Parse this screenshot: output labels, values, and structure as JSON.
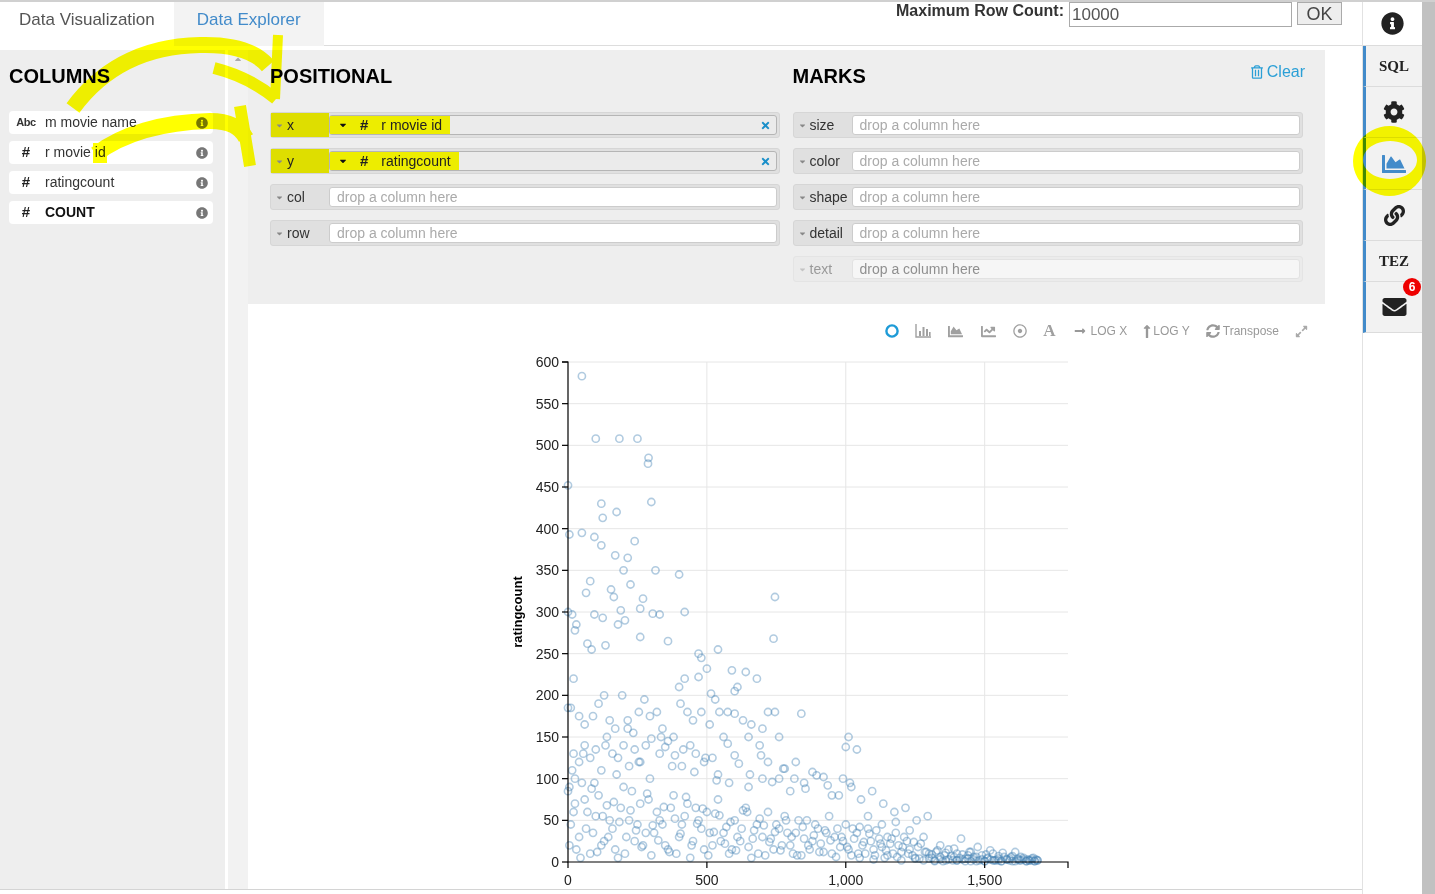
{
  "tabs": [
    {
      "label": "Data Visualization",
      "selected": true
    },
    {
      "label": "Data Explorer",
      "selected": false
    }
  ],
  "row_limit": {
    "label": "Maximum Row Count:",
    "value": "10000",
    "button": "OK"
  },
  "columns_panel": {
    "title": "COLUMNS",
    "items": [
      {
        "kind": "nominal",
        "type_label": "Abc",
        "name": "m movie name"
      },
      {
        "kind": "quantitative",
        "type_label": "#",
        "name": "r movie id"
      },
      {
        "kind": "quantitative",
        "type_label": "#",
        "name": "ratingcount"
      },
      {
        "kind": "count",
        "type_label": "#",
        "name": "COUNT"
      }
    ]
  },
  "positional": {
    "title": "POSITIONAL",
    "shelves": [
      {
        "channel": "x",
        "field": {
          "type_label": "#",
          "name": "r movie id"
        },
        "highlighted": true
      },
      {
        "channel": "y",
        "field": {
          "type_label": "#",
          "name": "ratingcount"
        },
        "highlighted": true
      },
      {
        "channel": "col",
        "placeholder": "drop a column here",
        "highlighted": false
      },
      {
        "channel": "row",
        "placeholder": "drop a column here",
        "highlighted": false
      }
    ]
  },
  "marks": {
    "title": "MARKS",
    "clear": "Clear",
    "shelves": [
      {
        "channel": "size",
        "placeholder": "drop a column here",
        "disabled": false
      },
      {
        "channel": "color",
        "placeholder": "drop a column here",
        "disabled": false
      },
      {
        "channel": "shape",
        "placeholder": "drop a column here",
        "disabled": false
      },
      {
        "channel": "detail",
        "placeholder": "drop a column here",
        "disabled": false
      },
      {
        "channel": "text",
        "placeholder": "drop a column here",
        "disabled": true
      }
    ]
  },
  "chart_toolbar": {
    "marks": [
      {
        "kind": "point",
        "selected": true
      },
      {
        "kind": "bar",
        "selected": false
      },
      {
        "kind": "area",
        "selected": false
      },
      {
        "kind": "line",
        "selected": false
      },
      {
        "kind": "circle",
        "selected": false
      },
      {
        "kind": "text",
        "label": "A",
        "selected": false
      }
    ],
    "toggles": [
      {
        "kind": "logx",
        "label": "LOG X"
      },
      {
        "kind": "logy",
        "label": "LOG Y"
      },
      {
        "kind": "transpose",
        "label": "Transpose"
      },
      {
        "kind": "expand"
      }
    ]
  },
  "chart": {
    "chart_data": {
      "type": "scatter",
      "ylabel": "ratingcount",
      "grid": true,
      "xlim": [
        0,
        1800
      ],
      "ylim": [
        0,
        600
      ],
      "xticks": [
        {
          "value": 0,
          "label": "0"
        },
        {
          "value": 500,
          "label": "500"
        },
        {
          "value": 1000,
          "label": "1,000"
        },
        {
          "value": 1500,
          "label": "1,500"
        }
      ],
      "yticks": [
        0,
        50,
        100,
        150,
        200,
        250,
        300,
        350,
        400,
        450,
        500,
        550,
        600
      ],
      "x": [
        50,
        100,
        185,
        250,
        290,
        288,
        0,
        300,
        120,
        175,
        125,
        5,
        50,
        95,
        120,
        240,
        170,
        215,
        400,
        315,
        200,
        80,
        225,
        65,
        155,
        165,
        270,
        745,
        740,
        420,
        0,
        15,
        95,
        190,
        260,
        305,
        330,
        125,
        205,
        180,
        30,
        25,
        70,
        85,
        135,
        260,
        360,
        470,
        540,
        480,
        500,
        590,
        640,
        680,
        420,
        470,
        600,
        610,
        400,
        515,
        530,
        20,
        0,
        10,
        40,
        60,
        90,
        110,
        130,
        150,
        170,
        195,
        215,
        235,
        255,
        275,
        295,
        320,
        340,
        360,
        380,
        405,
        430,
        450,
        480,
        510,
        545,
        575,
        600,
        630,
        660,
        700,
        720,
        745,
        760,
        840,
        1010,
        1000,
        1040,
        690,
        650,
        560,
        520,
        490,
        460,
        440,
        410,
        385,
        350,
        330,
        300,
        280,
        260,
        240,
        220,
        200,
        180,
        160,
        140,
        120,
        100,
        80,
        60,
        40,
        20,
        5,
        25,
        600,
        720,
        780,
        820,
        880,
        920,
        990,
        1020,
        950,
        850,
        800,
        760,
        700,
        650,
        580,
        540,
        0,
        20,
        40,
        60,
        80,
        100,
        120,
        140,
        160,
        180,
        200,
        220,
        240,
        260,
        280,
        300,
        320,
        340,
        360,
        380,
        400,
        420,
        440,
        460,
        480,
        500,
        520,
        540,
        560,
        580,
        600,
        620,
        640,
        660,
        680,
        700,
        720,
        740,
        760,
        780,
        800,
        820,
        840,
        860,
        880,
        900,
        920,
        940,
        960,
        980,
        1000,
        1020,
        1040,
        1060,
        1080,
        1100,
        1120,
        1140,
        1160,
        1180,
        1200,
        1220,
        1240,
        1260,
        1280,
        1300,
        10,
        30,
        50,
        70,
        90,
        110,
        130,
        150,
        170,
        190,
        210,
        230,
        250,
        270,
        290,
        310,
        330,
        350,
        370,
        390,
        410,
        430,
        450,
        470,
        490,
        510,
        530,
        550,
        570,
        590,
        610,
        630,
        650,
        670,
        690,
        710,
        730,
        750,
        770,
        790,
        810,
        830,
        850,
        870,
        890,
        910,
        930,
        950,
        970,
        990,
        1010,
        1030,
        1050,
        1070,
        1090,
        1110,
        1130,
        1150,
        1170,
        1190,
        1210,
        1230,
        1250,
        1270,
        1290,
        1310,
        1325,
        1340,
        1355,
        1370,
        1385,
        1400,
        1415,
        1430,
        1445,
        1460,
        1475,
        1490,
        1505,
        1520,
        1535,
        1550,
        1565,
        1580,
        1595,
        1610,
        1625,
        1640,
        1655,
        1670,
        1685,
        1340,
        1400,
        1450,
        1500,
        1550,
        1600,
        1650,
        1690,
        1320,
        1360,
        1390,
        1420,
        1440,
        1470,
        1510,
        1530,
        1560,
        1590,
        1620,
        1630,
        1660,
        1675,
        1680,
        1050,
        1100,
        1150,
        1200,
        1250,
        1280,
        1230,
        1180,
        1130,
        1080,
        5,
        25,
        45,
        65,
        85,
        105,
        125,
        145,
        165,
        185,
        205,
        225,
        245,
        265,
        285,
        305,
        325,
        345,
        365,
        385,
        405,
        425,
        445,
        465,
        485,
        505,
        525,
        545,
        565,
        585,
        605,
        625,
        645,
        665,
        685,
        705,
        725,
        745,
        765,
        785,
        805,
        825,
        845,
        865,
        885,
        905,
        925,
        945,
        965,
        985,
        1005,
        1025,
        1045,
        1065,
        1085,
        1105,
        1125,
        1145,
        1165,
        1185,
        1205,
        1225,
        1245,
        1265,
        1285,
        15,
        55,
        95,
        135,
        175,
        215,
        255,
        295,
        335,
        375,
        415,
        455,
        495,
        535,
        575,
        615,
        655,
        695,
        735,
        775,
        815,
        855,
        895,
        935,
        975,
        1015,
        1055,
        1095,
        1135,
        1175,
        1215,
        1255,
        1295,
        1300,
        1310,
        1320,
        1330,
        1340,
        1350,
        1360,
        1370,
        1380,
        1390,
        1400,
        1410,
        1420,
        1430,
        1440,
        1450,
        1460,
        1470,
        1480,
        1490,
        1500,
        1510,
        1520,
        1530,
        1540,
        1550,
        1560,
        1570,
        1580,
        1590,
        1600,
        1610,
        1620,
        1630,
        1640,
        1650,
        1660,
        1670,
        1680,
        1690
      ],
      "series": [
        {
          "color": "#4682b4",
          "values": [
            583,
            508,
            508,
            508,
            485,
            478,
            452,
            432,
            430,
            420,
            413,
            393,
            395,
            390,
            380,
            385,
            368,
            365,
            345,
            350,
            350,
            337,
            333,
            323,
            327,
            318,
            316,
            318,
            268,
            300,
            300,
            297,
            297,
            302,
            304,
            298,
            297,
            293,
            290,
            285,
            285,
            278,
            262,
            255,
            260,
            270,
            265,
            250,
            255,
            245,
            232,
            230,
            228,
            220,
            220,
            222,
            205,
            210,
            210,
            202,
            195,
            220,
            185,
            185,
            175,
            165,
            175,
            190,
            200,
            170,
            160,
            200,
            170,
            155,
            180,
            195,
            175,
            180,
            160,
            145,
            150,
            190,
            180,
            170,
            180,
            165,
            180,
            180,
            178,
            170,
            165,
            160,
            180,
            180,
            150,
            178,
            150,
            138,
            135,
            140,
            150,
            150,
            125,
            120,
            130,
            140,
            115,
            128,
            138,
            130,
            148,
            140,
            120,
            135,
            115,
            140,
            125,
            130,
            150,
            110,
            135,
            125,
            140,
            120,
            130,
            90,
            100,
            128,
            120,
            112,
            120,
            108,
            102,
            100,
            90,
            80,
            95,
            85,
            100,
            100,
            90,
            95,
            105,
            85,
            60,
            30,
            75,
            10,
            55,
            20,
            68,
            40,
            5,
            90,
            50,
            25,
            70,
            35,
            8,
            60,
            45,
            15,
            80,
            30,
            55,
            5,
            65,
            40,
            60,
            20,
            75,
            35,
            10,
            50,
            25,
            65,
            5,
            45,
            30,
            60,
            15,
            40,
            55,
            20,
            35,
            8,
            50,
            25,
            40,
            12,
            55,
            30,
            18,
            45,
            8,
            35,
            20,
            40,
            15,
            28,
            5,
            22,
            35,
            12,
            25,
            8,
            18,
            30,
            10,
            45,
            15,
            95,
            60,
            35,
            80,
            25,
            50,
            15,
            65,
            30,
            85,
            45,
            20,
            75,
            35,
            50,
            20,
            65,
            10,
            45,
            70,
            25,
            50,
            15,
            35,
            58,
            25,
            42,
            15,
            30,
            62,
            18,
            38,
            52,
            8,
            28,
            45,
            20,
            35,
            10,
            50,
            28,
            15,
            45,
            22,
            35,
            10,
            40,
            25,
            15,
            28,
            42,
            10,
            25,
            38,
            18,
            30,
            10,
            20,
            30,
            15,
            5,
            22,
            12,
            5,
            12,
            3,
            8,
            15,
            2,
            10,
            28,
            4,
            12,
            6,
            18,
            3,
            9,
            14,
            2,
            7,
            11,
            3,
            6,
            12,
            2,
            5,
            3,
            2,
            3,
            20,
            2,
            1,
            1,
            2,
            1,
            1,
            2,
            1,
            2,
            6,
            3,
            8,
            1,
            4,
            2,
            1,
            4,
            3,
            6,
            2,
            5,
            1,
            5,
            3,
            8,
            2,
            4,
            2,
            38,
            48,
            45,
            55,
            20,
            70,
            5,
            40,
            88,
            12,
            55,
            30,
            72,
            48,
            10,
            62,
            38,
            18,
            82,
            44,
            26,
            66,
            12,
            52,
            34,
            78,
            20,
            46,
            64,
            8,
            36,
            56,
            22,
            48,
            14,
            40,
            60,
            28,
            10,
            44,
            24,
            36,
            14,
            50,
            30,
            8,
            42,
            20,
            32,
            12,
            38,
            26,
            6,
            30,
            18,
            40,
            10,
            24,
            34,
            8,
            22,
            14,
            28,
            6,
            18,
            10,
            24,
            4,
            12,
            110,
            130,
            95,
            140,
            105,
            160,
            120,
            100,
            150,
            115,
            135,
            108,
            125,
            98,
            142,
            118,
            105,
            128,
            96,
            112,
            100,
            88,
            104,
            92,
            80,
            95,
            75,
            85,
            70,
            60,
            65,
            50,
            55,
            4,
            9,
            2,
            14,
            6,
            1,
            11,
            3,
            7,
            16,
            2,
            5,
            9,
            1,
            4,
            12,
            3,
            6,
            2,
            8,
            1,
            5,
            3,
            10,
            2,
            4,
            1,
            6,
            3,
            2,
            7,
            1,
            4,
            2,
            3,
            1,
            2,
            4,
            1,
            2
          ]
        }
      ]
    }
  },
  "sidebar": {
    "items": [
      {
        "kind": "info"
      },
      {
        "kind": "label",
        "label": "SQL"
      },
      {
        "kind": "settings"
      },
      {
        "kind": "chart"
      },
      {
        "kind": "link"
      },
      {
        "kind": "label",
        "label": "TEZ"
      },
      {
        "kind": "mail",
        "badge": "6"
      }
    ]
  },
  "highlighter_marks": [
    {
      "kind": "upperarrow"
    },
    {
      "kind": "lowerarrow"
    },
    {
      "kind": "sidebarring"
    }
  ]
}
